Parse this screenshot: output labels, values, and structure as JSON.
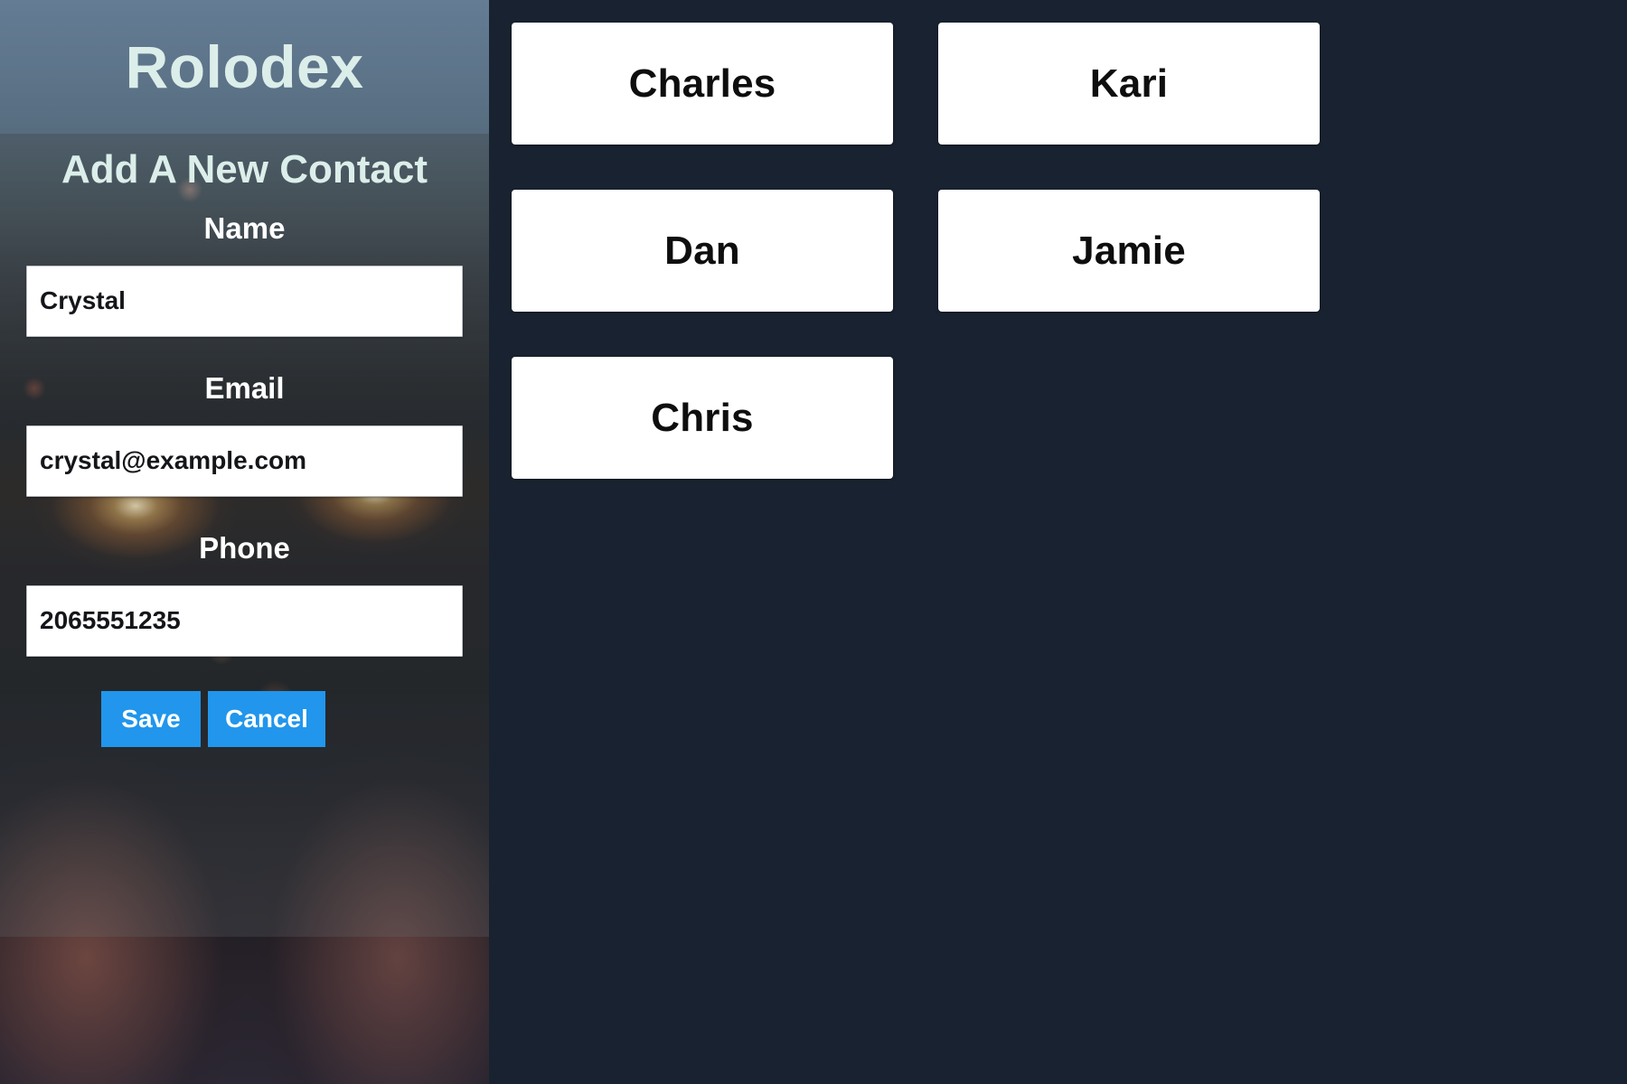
{
  "app": {
    "title": "Rolodex",
    "background_color": "#192230",
    "accent_color": "#2196ec",
    "title_color": "#dceee9",
    "card_color": "#ffffff"
  },
  "sidebar": {
    "form_title": "Add A New Contact",
    "fields": [
      {
        "label": "Name",
        "value": "Crystal",
        "placeholder": "Name",
        "name": "name-field"
      },
      {
        "label": "Email",
        "value": "crystal@example.com",
        "placeholder": "Email",
        "name": "email-field"
      },
      {
        "label": "Phone",
        "value": "2065551235",
        "placeholder": "Phone",
        "name": "phone-field"
      }
    ],
    "buttons": {
      "save_label": "Save",
      "cancel_label": "Cancel"
    }
  },
  "contacts": {
    "items": [
      {
        "name": "Charles"
      },
      {
        "name": "Kari"
      },
      {
        "name": "Dan"
      },
      {
        "name": "Jamie"
      },
      {
        "name": "Chris"
      }
    ]
  }
}
